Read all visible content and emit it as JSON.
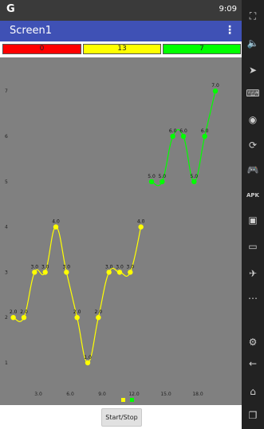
{
  "status_bar": {
    "logo": "G",
    "time": "9:09"
  },
  "app_bar": {
    "title": "Screen1",
    "menu_glyph": "⋮"
  },
  "counters": [
    {
      "value": "0",
      "color": "#ff0000"
    },
    {
      "value": "13",
      "color": "#ffff00"
    },
    {
      "value": "7",
      "color": "#00ff00"
    }
  ],
  "buttons": {
    "start_stop": "Start/Stop"
  },
  "sidebar": {
    "icons": [
      "fullscreen-icon",
      "volume-icon",
      "cursor-icon",
      "keyboard-icon",
      "record-icon",
      "rotate-icon",
      "gamepad-icon",
      "apk-install-icon",
      "screenshot-icon",
      "folder-icon",
      "location-icon",
      "more-icon",
      "settings-icon",
      "back-icon",
      "home-icon",
      "recent-apps-icon"
    ]
  },
  "chart_data": {
    "type": "line",
    "xlim": [
      0,
      21
    ],
    "ylim": [
      0.5,
      7.5
    ],
    "x_ticks": [
      "3.0",
      "6.0",
      "9.0",
      "12.0",
      "15.0",
      "18.0"
    ],
    "y_ticks": [
      "1",
      "2",
      "3",
      "4",
      "5",
      "6",
      "7"
    ],
    "series": [
      {
        "color": "#ffff00",
        "points": [
          [
            0.5,
            2.0
          ],
          [
            1.5,
            2.0
          ],
          [
            2.5,
            3.0
          ],
          [
            3.5,
            3.0
          ],
          [
            4.5,
            4.0
          ],
          [
            5.5,
            3.0
          ],
          [
            6.5,
            2.0
          ],
          [
            7.5,
            1.0
          ],
          [
            8.5,
            2.0
          ],
          [
            9.5,
            3.0
          ],
          [
            10.5,
            3.0
          ],
          [
            11.5,
            3.0
          ],
          [
            12.5,
            4.0
          ]
        ],
        "labels": [
          "2.0",
          "2.0",
          "3.0",
          "3.0",
          "4.0",
          "3.0",
          "2.0",
          "1.0",
          "2.0",
          "3.0",
          "3.0",
          "3.0",
          "4.0"
        ]
      },
      {
        "color": "#00ff00",
        "points": [
          [
            13.5,
            5.0
          ],
          [
            14.5,
            5.0
          ],
          [
            15.5,
            6.0
          ],
          [
            16.5,
            6.0
          ],
          [
            17.5,
            5.0
          ],
          [
            18.5,
            6.0
          ],
          [
            19.5,
            7.0
          ]
        ],
        "labels": [
          "5.0",
          "5.0",
          "6.0",
          "6.0",
          "5.0",
          "6.0",
          "7.0"
        ]
      }
    ],
    "legend": {
      "position": "bottom-center",
      "colors": [
        "#ffff00",
        "#00ff00"
      ]
    },
    "grid": false
  }
}
